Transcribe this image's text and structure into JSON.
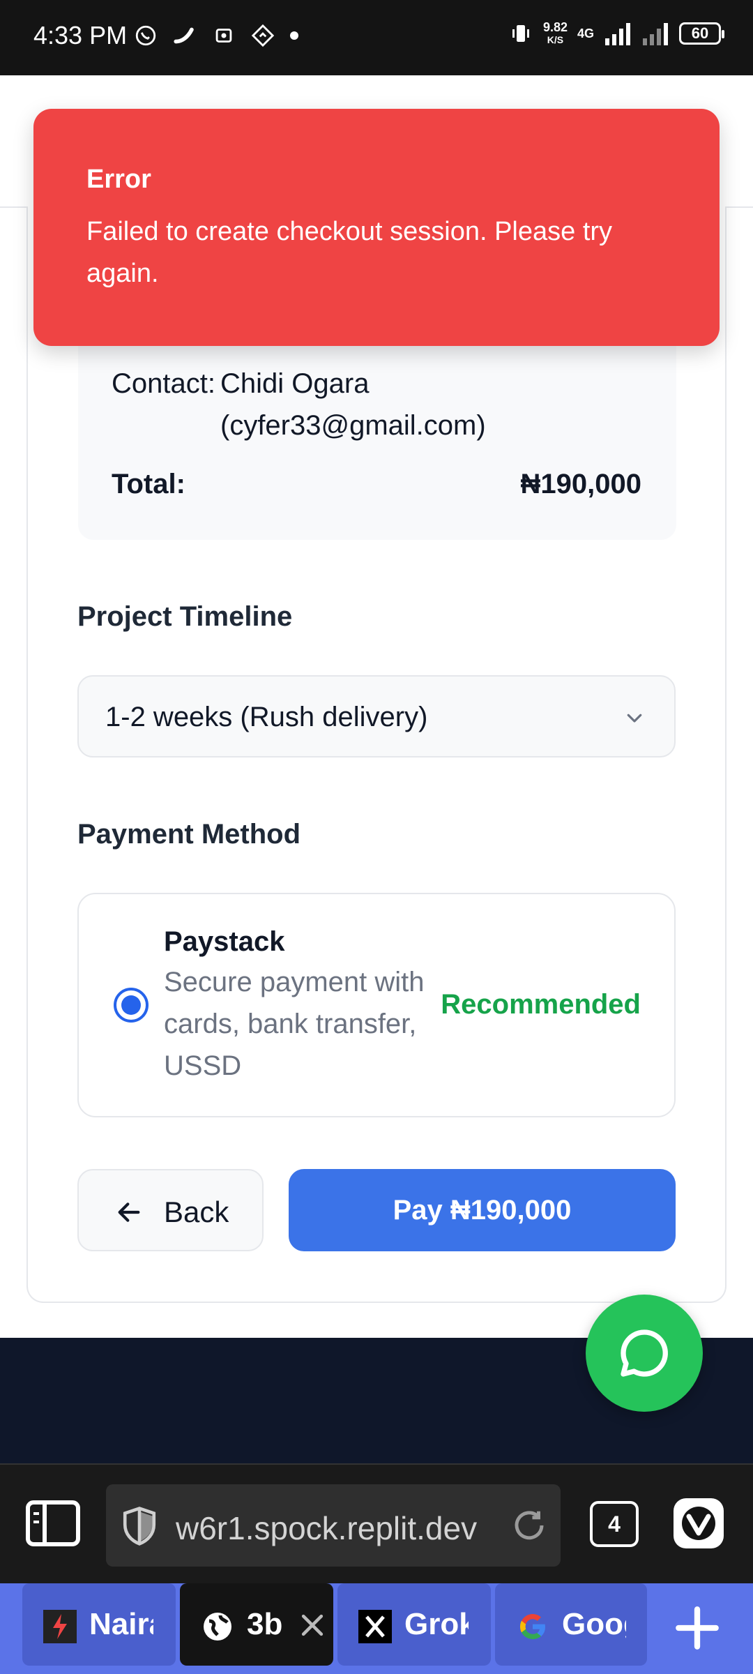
{
  "status_bar": {
    "time": "4:33 PM",
    "speed_value": "9.82",
    "speed_unit": "K/S",
    "network": "4G",
    "battery": "60"
  },
  "summary": {
    "contact_label": "Contact:",
    "contact_name": "Chidi Ogara",
    "contact_email": "(cyfer33@gmail.com)",
    "total_label": "Total:",
    "total_value": "₦190,000"
  },
  "timeline": {
    "title": "Project Timeline",
    "selected": "1-2 weeks (Rush delivery)"
  },
  "payment": {
    "title": "Payment Method",
    "option_title": "Paystack",
    "option_desc": "Secure payment with cards, bank transfer, USSD",
    "badge": "Recommended",
    "badge_color": "#16a34a"
  },
  "actions": {
    "back_label": "Back",
    "pay_label": "Pay ₦190,000",
    "pay_color": "#3b73e8"
  },
  "toast": {
    "title": "Error",
    "message": "Failed to create checkout session. Please try again.",
    "color": "#ef4444"
  },
  "browser": {
    "url": "w6r1.spock.replit.dev",
    "tab_count": "4"
  },
  "tabs": [
    {
      "title": "Naira",
      "icon": "naira-site-icon"
    },
    {
      "title": "3b",
      "icon": "globe-icon",
      "active": true
    },
    {
      "title": "Grok",
      "icon": "x-icon"
    },
    {
      "title": "Google",
      "icon": "google-icon"
    }
  ]
}
